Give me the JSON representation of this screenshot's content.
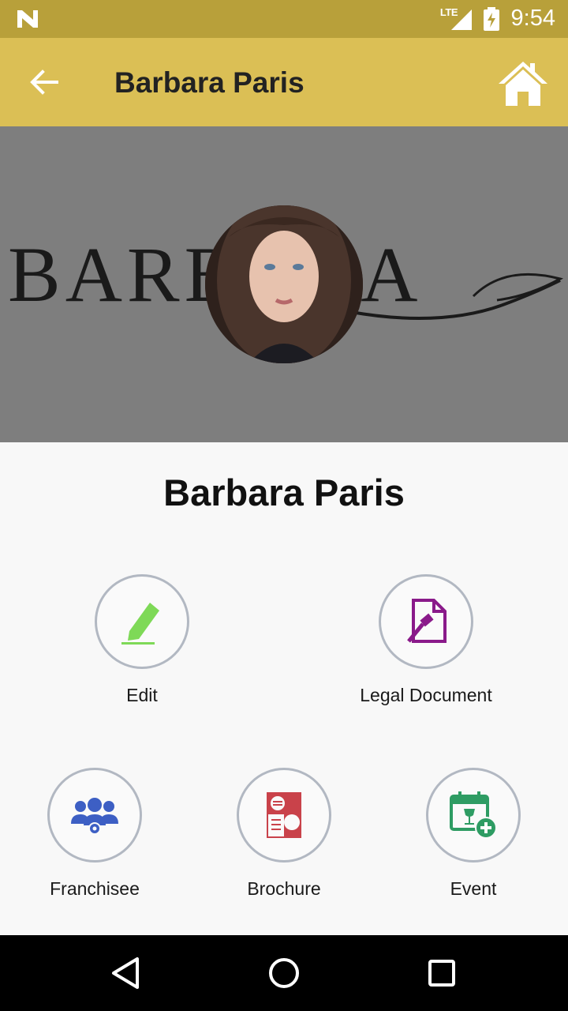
{
  "status_bar": {
    "network": "LTE",
    "time": "9:54"
  },
  "app_bar": {
    "title": "Barbara Paris"
  },
  "cover": {
    "brand_text": "BARBARA"
  },
  "profile": {
    "name": "Barbara Paris"
  },
  "actions": [
    {
      "label": "Edit",
      "icon": "edit-icon",
      "color": "#7ed957"
    },
    {
      "label": "Legal Document",
      "icon": "legal-document-icon",
      "color": "#8a1a8a"
    },
    {
      "label": "Franchisee",
      "icon": "franchisee-icon",
      "color": "#3d5fc4"
    },
    {
      "label": "Brochure",
      "icon": "brochure-icon",
      "color": "#c9424a"
    },
    {
      "label": "Event",
      "icon": "event-icon",
      "color": "#2e9c63"
    }
  ],
  "colors": {
    "status_bar": "#b8a03a",
    "app_bar": "#dbbf55",
    "cover_bg": "#7e7e7e",
    "circle_border": "#b2b8c2"
  }
}
